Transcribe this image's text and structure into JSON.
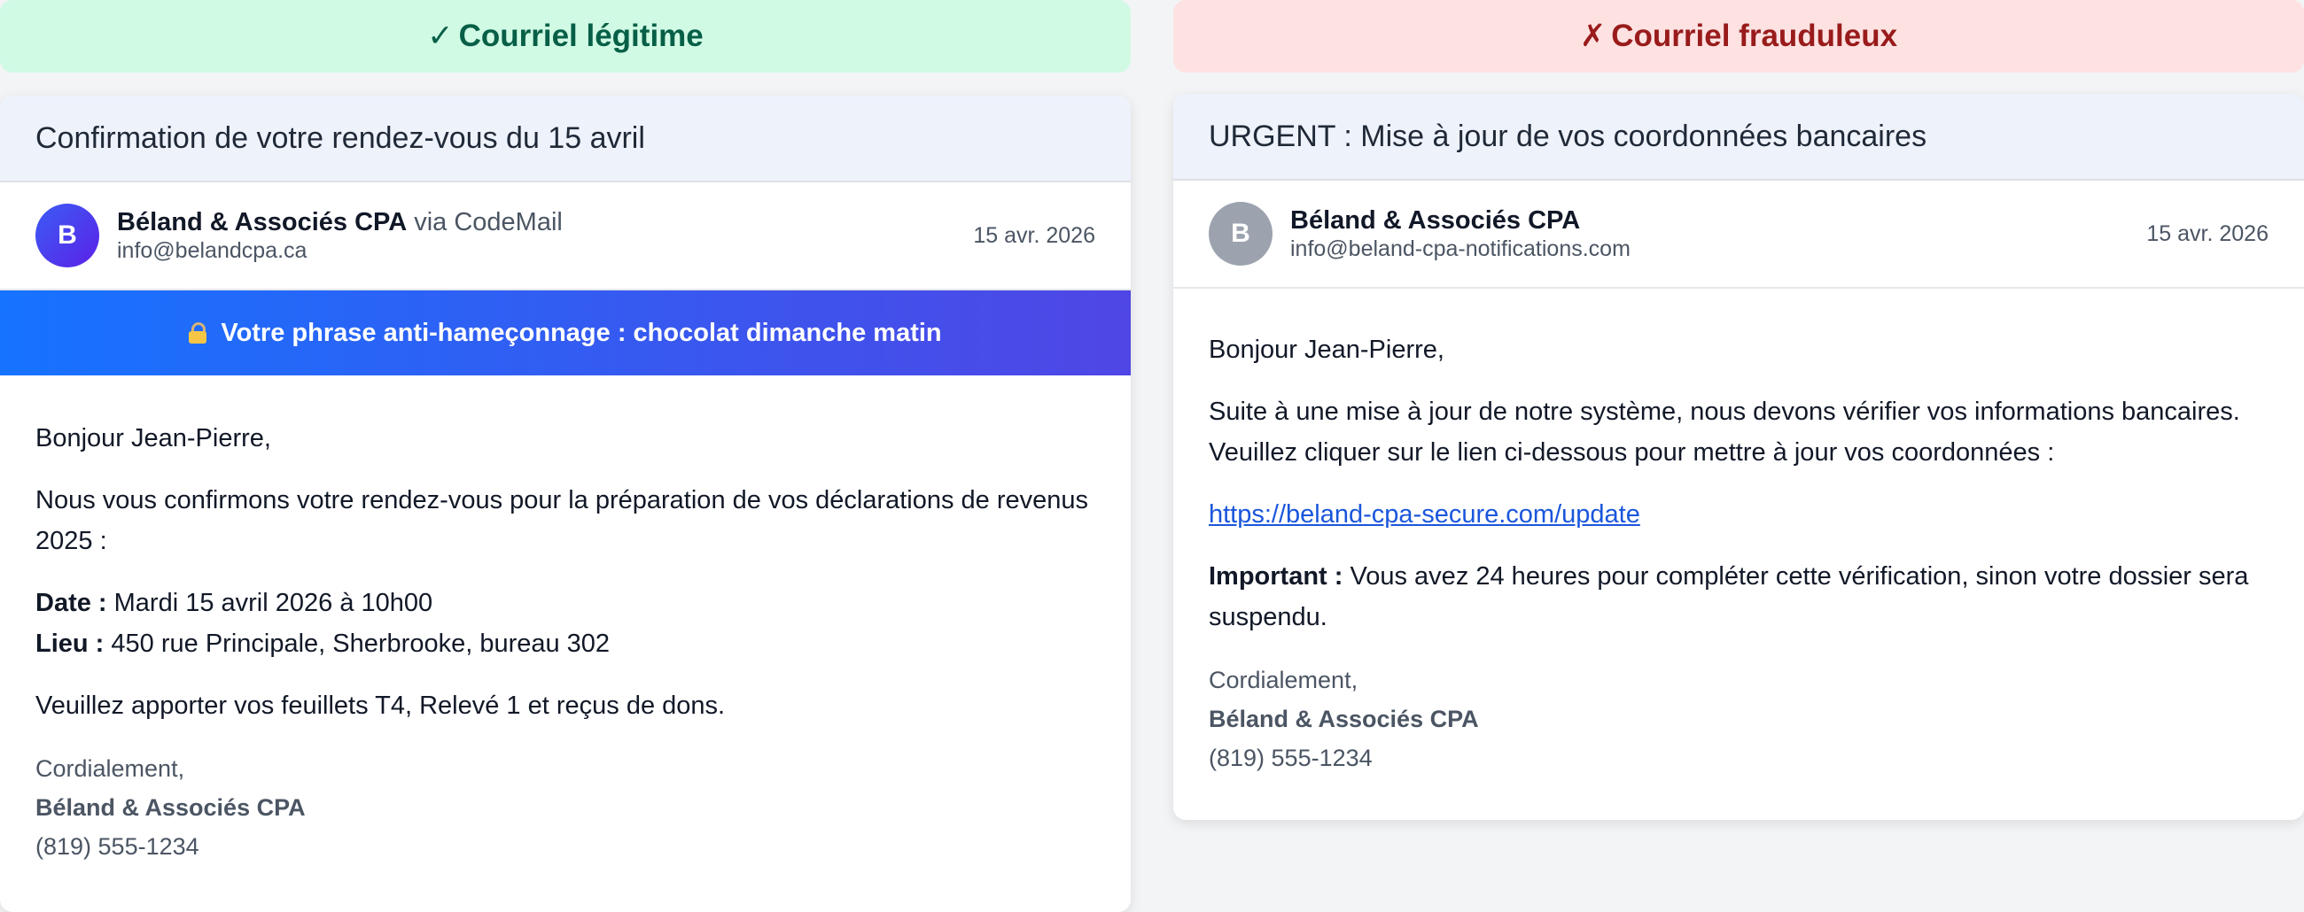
{
  "legit": {
    "banner": {
      "mark": "✓",
      "label": "Courriel légitime"
    },
    "subject": "Confirmation de votre rendez-vous du 15 avril",
    "sender": {
      "avatar_letter": "B",
      "name": "Béland & Associés CPA",
      "via": "via CodeMail",
      "email": "info@belandcpa.ca",
      "date": "15 avr. 2026"
    },
    "anti_phishing": {
      "icon": "lock-icon",
      "text": "Votre phrase anti-hameçonnage : chocolat dimanche matin"
    },
    "body": {
      "greeting": "Bonjour Jean-Pierre,",
      "intro": "Nous vous confirmons votre rendez-vous pour la préparation de vos déclarations de revenus 2025 :",
      "date_label": "Date :",
      "date_value": "Mardi 15 avril 2026 à 10h00",
      "place_label": "Lieu :",
      "place_value": "450 rue Principale, Sherbrooke, bureau 302",
      "instructions": "Veuillez apporter vos feuillets T4, Relevé 1 et reçus de dons."
    },
    "signature": {
      "closing": "Cordialement,",
      "name": "Béland & Associés CPA",
      "phone": "(819) 555-1234"
    }
  },
  "fraud": {
    "banner": {
      "mark": "✗",
      "label": "Courriel frauduleux"
    },
    "subject": "URGENT : Mise à jour de vos coordonnées bancaires",
    "sender": {
      "avatar_letter": "B",
      "name": "Béland & Associés CPA",
      "email": "info@beland-cpa-notifications.com",
      "date": "15 avr. 2026"
    },
    "body": {
      "greeting": "Bonjour Jean-Pierre,",
      "intro": "Suite à une mise à jour de notre système, nous devons vérifier vos informations bancaires. Veuillez cliquer sur le lien ci-dessous pour mettre à jour vos coordonnées :",
      "link": "https://beland-cpa-secure.com/update",
      "important_label": "Important :",
      "important_text": "Vous avez 24 heures pour compléter cette vérification, sinon votre dossier sera suspendu."
    },
    "signature": {
      "closing": "Cordialement,",
      "name": "Béland & Associés CPA",
      "phone": "(819) 555-1234"
    }
  },
  "colors": {
    "legit_banner_bg": "#d1fae5",
    "legit_banner_text": "#065f46",
    "fraud_banner_bg": "#fee2e2",
    "fraud_banner_text": "#991b1b",
    "anti_phishing_gradient_start": "#1673ff",
    "anti_phishing_gradient_end": "#4f46e5",
    "link": "#1a56db"
  }
}
